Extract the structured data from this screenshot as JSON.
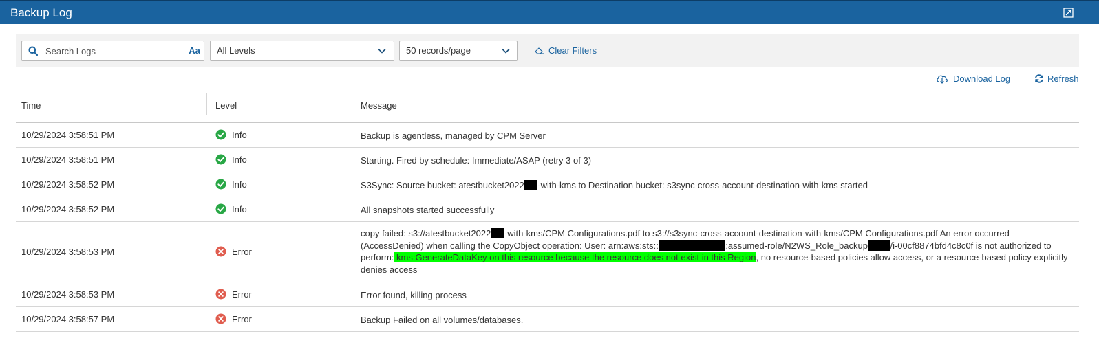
{
  "window": {
    "title": "Backup Log",
    "brand_color": "#1a639f",
    "icons": {
      "expand": "expand-icon"
    }
  },
  "filters": {
    "search": {
      "placeholder": "Search Logs",
      "value": "",
      "case_toggle_label": "Aa",
      "icon": "search-icon"
    },
    "level_select": {
      "value": "All Levels",
      "icon": "chevron-down-icon"
    },
    "page_size_select": {
      "value": "50 records/page",
      "icon": "chevron-down-icon"
    },
    "clear_filters_label": "Clear Filters",
    "clear_filters_icon": "eraser-icon"
  },
  "actions": {
    "download_label": "Download Log",
    "download_icon": "cloud-download-icon",
    "refresh_label": "Refresh",
    "refresh_icon": "refresh-icon"
  },
  "table": {
    "columns": [
      "Time",
      "Level",
      "Message"
    ],
    "level_colors": {
      "Info": "#28a745",
      "Error": "#e05d4f"
    },
    "highlight_color": "#00ff00",
    "rows": [
      {
        "time": "10/29/2024 3:58:51 PM",
        "level": "Info",
        "message": [
          "Backup is agentless, managed by CPM Server"
        ]
      },
      {
        "time": "10/29/2024 3:58:51 PM",
        "level": "Info",
        "message": [
          "Starting. Fired by schedule: Immediate/ASAP (retry 3 of 3)"
        ]
      },
      {
        "time": "10/29/2024 3:58:52 PM",
        "level": "Info",
        "message": [
          "S3Sync: Source bucket: atestbucket2022",
          {
            "redacted": "xxx"
          },
          "-with-kms to Destination bucket: s3sync-cross-account-destination-with-kms started"
        ]
      },
      {
        "time": "10/29/2024 3:58:52 PM",
        "level": "Info",
        "message": [
          "All snapshots started successfully"
        ]
      },
      {
        "time": "10/29/2024 3:58:53 PM",
        "level": "Error",
        "tall": true,
        "message": [
          "copy failed: s3://atestbucket2022",
          {
            "redacted": "xxx"
          },
          "-with-kms/CPM Configurations.pdf to s3://s3sync-cross-account-destination-with-kms/CPM Configurations.pdf An error occurred (AccessDenied) when calling the CopyObject operation: User: arn:aws:sts::",
          {
            "redacted": "xxxxxxxxxxxxxxx"
          },
          ":assumed-role/N2WS_Role_backup",
          {
            "redacted": "xxxxx"
          },
          "/i-00cf8874bfd4c8c0f is not authorized to perform:",
          {
            "highlight": " kms:GenerateDataKey on this resource because the resource does not exist in this Region"
          },
          ", no resource-based policies allow access, or a resource-based policy explicitly denies access"
        ]
      },
      {
        "time": "10/29/2024 3:58:53 PM",
        "level": "Error",
        "message": [
          "Error found, killing process"
        ]
      },
      {
        "time": "10/29/2024 3:58:57 PM",
        "level": "Error",
        "message": [
          "Backup Failed on all volumes/databases."
        ]
      }
    ]
  }
}
